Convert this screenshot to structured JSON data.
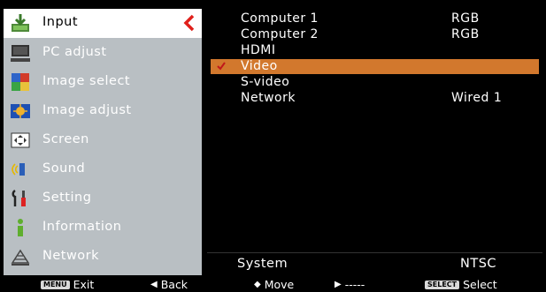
{
  "menu": {
    "items": [
      {
        "label": "Input",
        "icon": "input-icon",
        "active": true
      },
      {
        "label": "PC adjust",
        "icon": "pc-adjust-icon"
      },
      {
        "label": "Image select",
        "icon": "image-select-icon"
      },
      {
        "label": "Image adjust",
        "icon": "image-adjust-icon"
      },
      {
        "label": "Screen",
        "icon": "screen-icon"
      },
      {
        "label": "Sound",
        "icon": "sound-icon"
      },
      {
        "label": "Setting",
        "icon": "setting-icon"
      },
      {
        "label": "Information",
        "icon": "information-icon"
      },
      {
        "label": "Network",
        "icon": "network-icon"
      }
    ]
  },
  "options": [
    {
      "label": "Computer 1",
      "value": "RGB"
    },
    {
      "label": "Computer 2",
      "value": "RGB"
    },
    {
      "label": "HDMI",
      "value": ""
    },
    {
      "label": "Video",
      "value": "",
      "selected": true
    },
    {
      "label": "S-video",
      "value": ""
    },
    {
      "label": "Network",
      "value": "Wired 1"
    }
  ],
  "system": {
    "label": "System",
    "value": "NTSC"
  },
  "hints": {
    "exit_key": "MENU",
    "exit": "Exit",
    "back": "Back",
    "move": "Move",
    "next": "-----",
    "select_key": "SELECT",
    "select": "Select"
  },
  "colors": {
    "highlight": "#d2782d",
    "panel": "#b9bfc3",
    "chevron": "#e0201b"
  }
}
